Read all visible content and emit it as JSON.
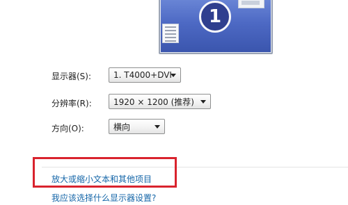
{
  "monitor": {
    "number": "1"
  },
  "display": {
    "label": "显示器(S):",
    "selected": "1. T4000+DVI"
  },
  "resolution": {
    "label": "分辨率(R):",
    "selected": "1920 × 1200 (推荐)"
  },
  "orientation": {
    "label": "方向(O):",
    "selected": "横向"
  },
  "links": {
    "enlarge_text": "放大或缩小文本和其他项目",
    "which_settings": "我应该选择什么显示器设置?"
  },
  "colors": {
    "link": "#1566a8",
    "highlight_box": "#d9232d",
    "monitor_screen": "#4d69c4"
  }
}
